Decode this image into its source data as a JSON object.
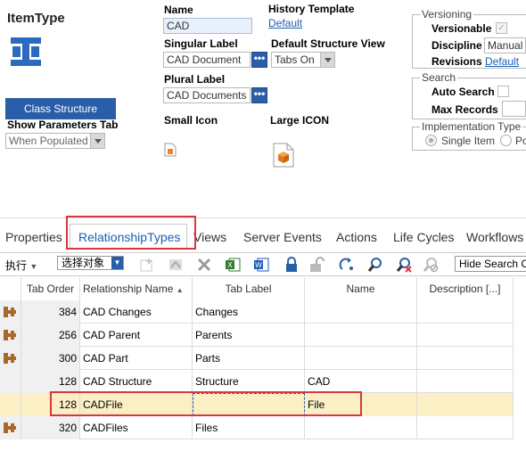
{
  "form": {
    "title": "ItemType",
    "name_label": "Name",
    "name_value": "CAD",
    "history_label": "History Template",
    "history_value": "Default",
    "singular_label": "Singular Label",
    "singular_value": "CAD Document",
    "default_view_label": "Default Structure View",
    "default_view_value": "Tabs On",
    "plural_label": "Plural Label",
    "plural_value": "CAD Documents",
    "small_icon_label": "Small Icon",
    "large_icon_label": "Large ICON",
    "class_structure_button": "Class Structure",
    "show_params_label": "Show Parameters Tab",
    "show_params_value": "When Populated",
    "dots": "•••"
  },
  "versioning": {
    "legend": "Versioning",
    "versionable_label": "Versionable",
    "versionable_checked": true,
    "discipline_label": "Discipline",
    "discipline_value": "Manual",
    "revisions_label": "Revisions",
    "revisions_value": "Default"
  },
  "search": {
    "legend": "Search",
    "auto_search_label": "Auto Search",
    "max_records_label": "Max Records",
    "max_records_value": ""
  },
  "implementation": {
    "legend": "Implementation Type",
    "options": [
      "Single Item",
      "Po"
    ],
    "selected": "Single Item"
  },
  "tabs": [
    "Properties",
    "RelationshipTypes",
    "Views",
    "Server Events",
    "Actions",
    "Life Cycles",
    "Workflows"
  ],
  "active_tab": "RelationshipTypes",
  "toolbar": {
    "execute_label": "执行",
    "select_object_label": "选择对象",
    "hide_search_label": "Hide Search C"
  },
  "grid": {
    "columns": [
      "",
      "Tab Order",
      "Relationship Name",
      "Tab Label",
      "Name",
      "Description [...]"
    ],
    "sort_indicator": "▲",
    "rows": [
      {
        "icon": true,
        "tab_order": "384",
        "rel_name": "CAD Changes",
        "tab_label": "Changes",
        "name": "",
        "desc": ""
      },
      {
        "icon": true,
        "tab_order": "256",
        "rel_name": "CAD Parent",
        "tab_label": "Parents",
        "name": "",
        "desc": ""
      },
      {
        "icon": true,
        "tab_order": "300",
        "rel_name": "CAD Part",
        "tab_label": "Parts",
        "name": "",
        "desc": ""
      },
      {
        "icon": false,
        "tab_order": "128",
        "rel_name": "CAD Structure",
        "tab_label": "Structure",
        "name": "CAD",
        "desc": ""
      },
      {
        "icon": false,
        "tab_order": "128",
        "rel_name": "CADFile",
        "tab_label": "",
        "name": "File",
        "desc": "",
        "selected": true
      },
      {
        "icon": true,
        "tab_order": "320",
        "rel_name": "CADFiles",
        "tab_label": "Files",
        "name": "",
        "desc": ""
      }
    ]
  },
  "colors": {
    "accent": "#2b5ea8",
    "highlight": "#d9363e",
    "selected_row": "#fbefc6"
  }
}
